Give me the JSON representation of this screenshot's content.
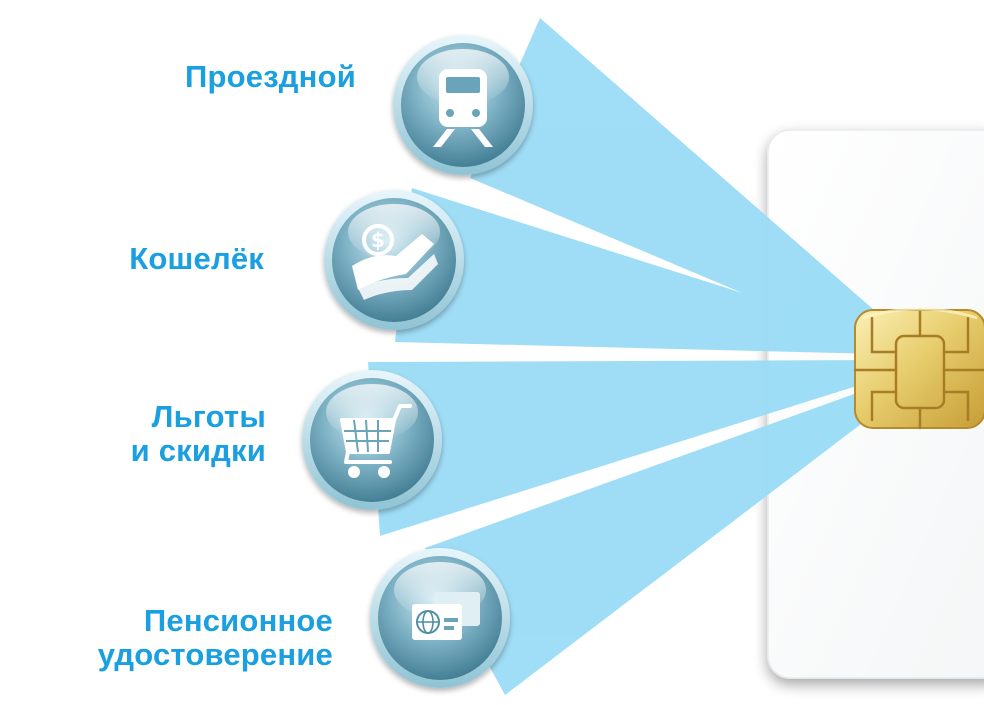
{
  "items": [
    {
      "id": "transit-pass",
      "lines": [
        "Проездной"
      ],
      "icon": "train-icon"
    },
    {
      "id": "wallet",
      "lines": [
        "Кошелёк"
      ],
      "icon": "money-icon"
    },
    {
      "id": "benefits",
      "lines": [
        "Льготы",
        "и скидки"
      ],
      "icon": "shopping-cart-icon"
    },
    {
      "id": "pension-certificate",
      "lines": [
        "Пенсионное",
        "удостоверение"
      ],
      "icon": "id-cards-icon"
    }
  ],
  "colors": {
    "label": "#1a9fe0",
    "beam": "#9adcf6",
    "icon_dark": "#3e7d92",
    "icon_light": "#b9dde8",
    "chip_gold": "#e9d27a",
    "card": "#ffffff"
  }
}
